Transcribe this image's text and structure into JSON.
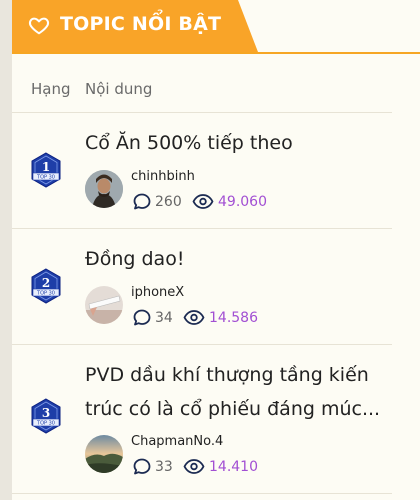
{
  "header": {
    "title": "TOPIC NỔI BẬT"
  },
  "columns": {
    "rank": "Hạng",
    "content": "Nội dung"
  },
  "topics": [
    {
      "rank": "1",
      "badge_text": "TOP 30",
      "title_line1": "Cổ Ăn 500% tiếp theo",
      "title_line2": "",
      "user": "chinhbinh",
      "comments": "260",
      "views": "49.060"
    },
    {
      "rank": "2",
      "badge_text": "TOP 30",
      "title_line1": "Đồng dao!",
      "title_line2": "",
      "user": "iphoneX",
      "comments": "34",
      "views": "14.586"
    },
    {
      "rank": "3",
      "badge_text": "TOP 30",
      "title_line1": "PVD dầu khí thượng tầng kiến",
      "title_line2": "trúc có là cổ phiếu đáng múc...",
      "user": "ChapmanNo.4",
      "comments": "33",
      "views": "14.410"
    }
  ],
  "colors": {
    "accent": "#f9a428",
    "views": "#a24fd3",
    "badge": "#1e3ea8"
  }
}
